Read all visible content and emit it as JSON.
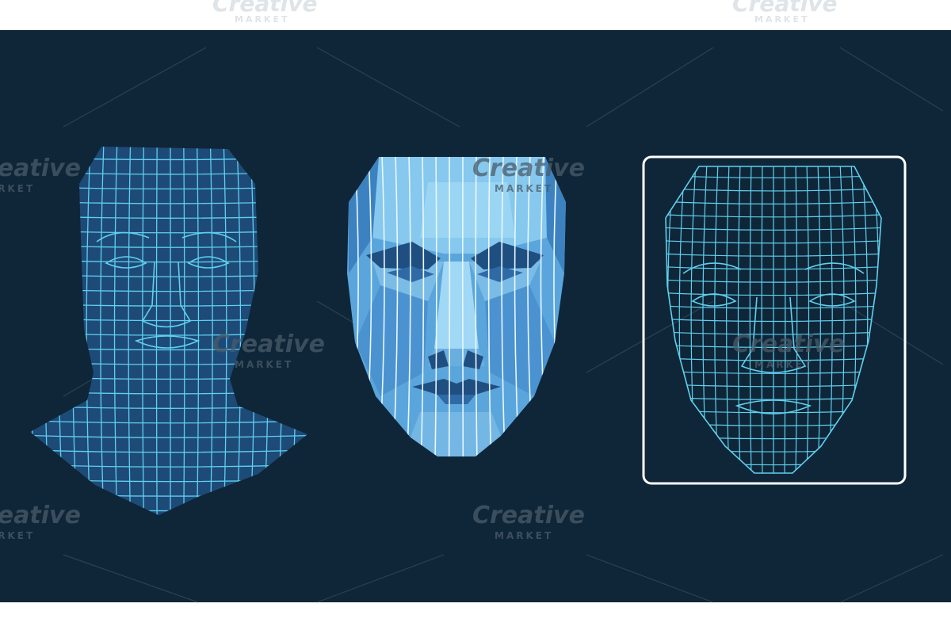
{
  "watermark": {
    "word": "Creative",
    "sub": "MARKET"
  },
  "colors": {
    "page_background": "#ffffff",
    "panel_background": "#0f2638",
    "wire_line": "#5fd0ee",
    "head_fill_dark": "#1e4a78",
    "face_fill_light": "#5aa6dc",
    "face_fill_lighter": "#86c8ee",
    "face_shadow": "#2e6aa6",
    "scan_frame": "#ffffff",
    "watermark_dark": "#4a5c6a",
    "watermark_light": "#dfe4e8"
  },
  "figures": {
    "wireframe_head": "head-and-shoulders-wireframe",
    "polygon_face": "low-poly-shaded-face",
    "scanned_face": "wireframe-face-in-scan-frame"
  }
}
